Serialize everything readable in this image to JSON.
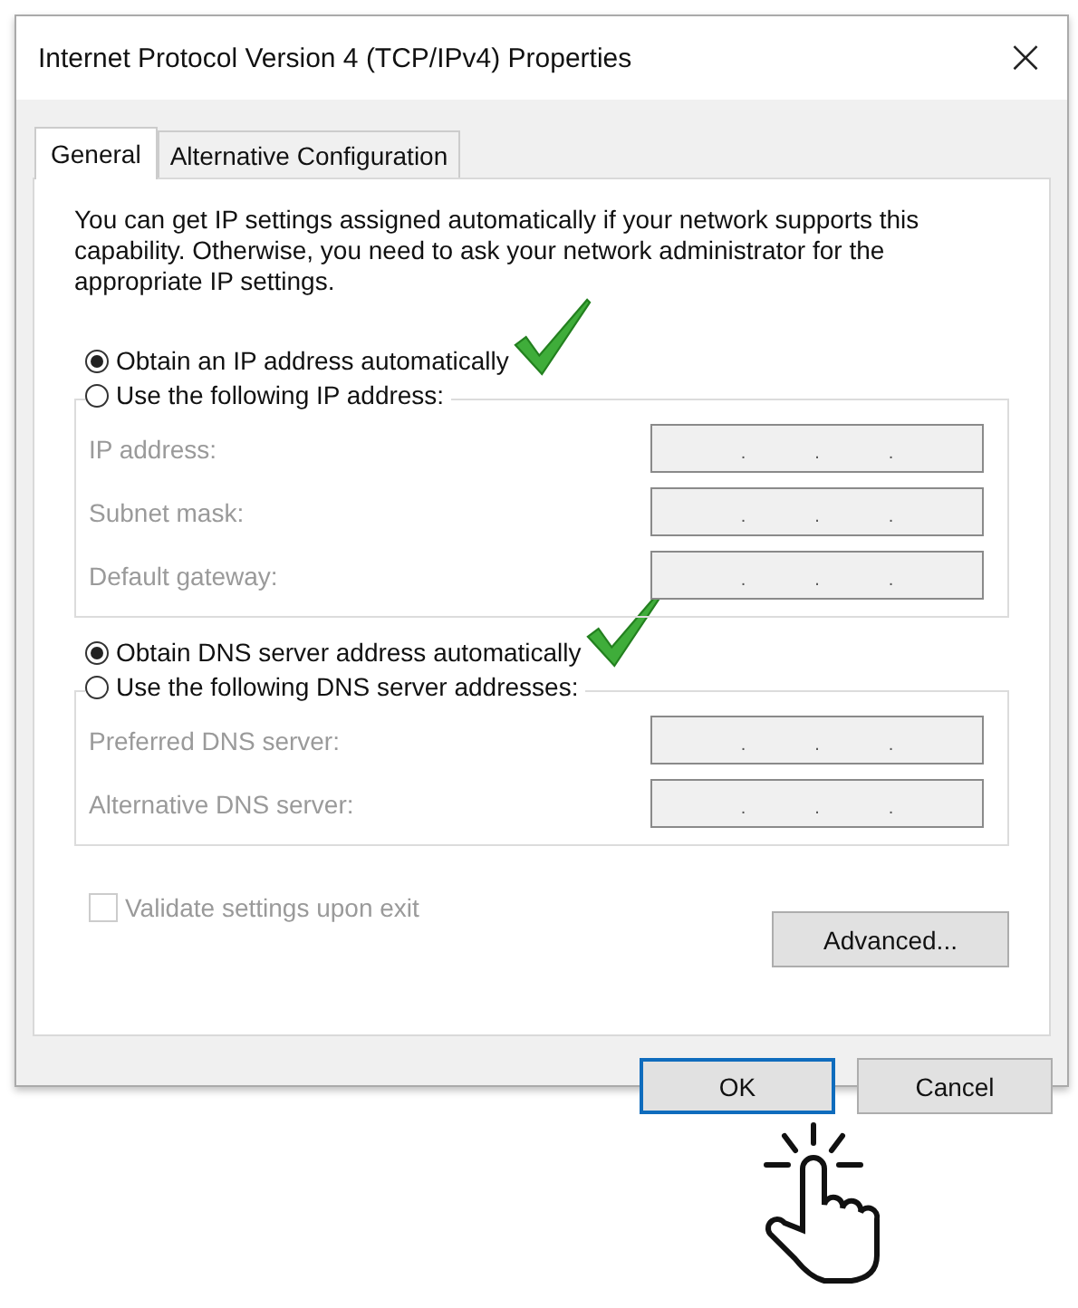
{
  "window": {
    "title": "Internet Protocol Version 4 (TCP/IPv4) Properties",
    "close": "×"
  },
  "tabs": [
    {
      "label": "General",
      "selected": true
    },
    {
      "label": "Alternative Configuration",
      "selected": false
    }
  ],
  "description": "You can get IP settings assigned automatically if your network supports this capability. Otherwise, you need to ask your network administrator for the appropriate IP settings.",
  "ip": {
    "auto": {
      "label": "Obtain an IP address automatically",
      "selected": true
    },
    "manual": {
      "label": "Use the following IP address:",
      "selected": false
    },
    "fields": [
      {
        "label": "IP address:",
        "dots": [
          ".",
          ".",
          "."
        ],
        "disabled": true
      },
      {
        "label": "Subnet mask:",
        "dots": [
          ".",
          ".",
          "."
        ],
        "disabled": true
      },
      {
        "label": "Default gateway:",
        "dots": [
          ".",
          ".",
          "."
        ],
        "disabled": true
      }
    ]
  },
  "dns": {
    "auto": {
      "label": "Obtain DNS server address automatically",
      "selected": true
    },
    "manual": {
      "label": "Use the following DNS server addresses:",
      "selected": false
    },
    "fields": [
      {
        "label": "Preferred DNS server:",
        "dots": [
          ".",
          ".",
          "."
        ],
        "disabled": true
      },
      {
        "label": "Alternative DNS server:",
        "dots": [
          ".",
          ".",
          "."
        ],
        "disabled": true
      }
    ]
  },
  "validate": {
    "label": "Validate settings upon exit",
    "checked": false,
    "disabled": true
  },
  "buttons": {
    "advanced": "Advanced...",
    "ok": "OK",
    "cancel": "Cancel"
  }
}
